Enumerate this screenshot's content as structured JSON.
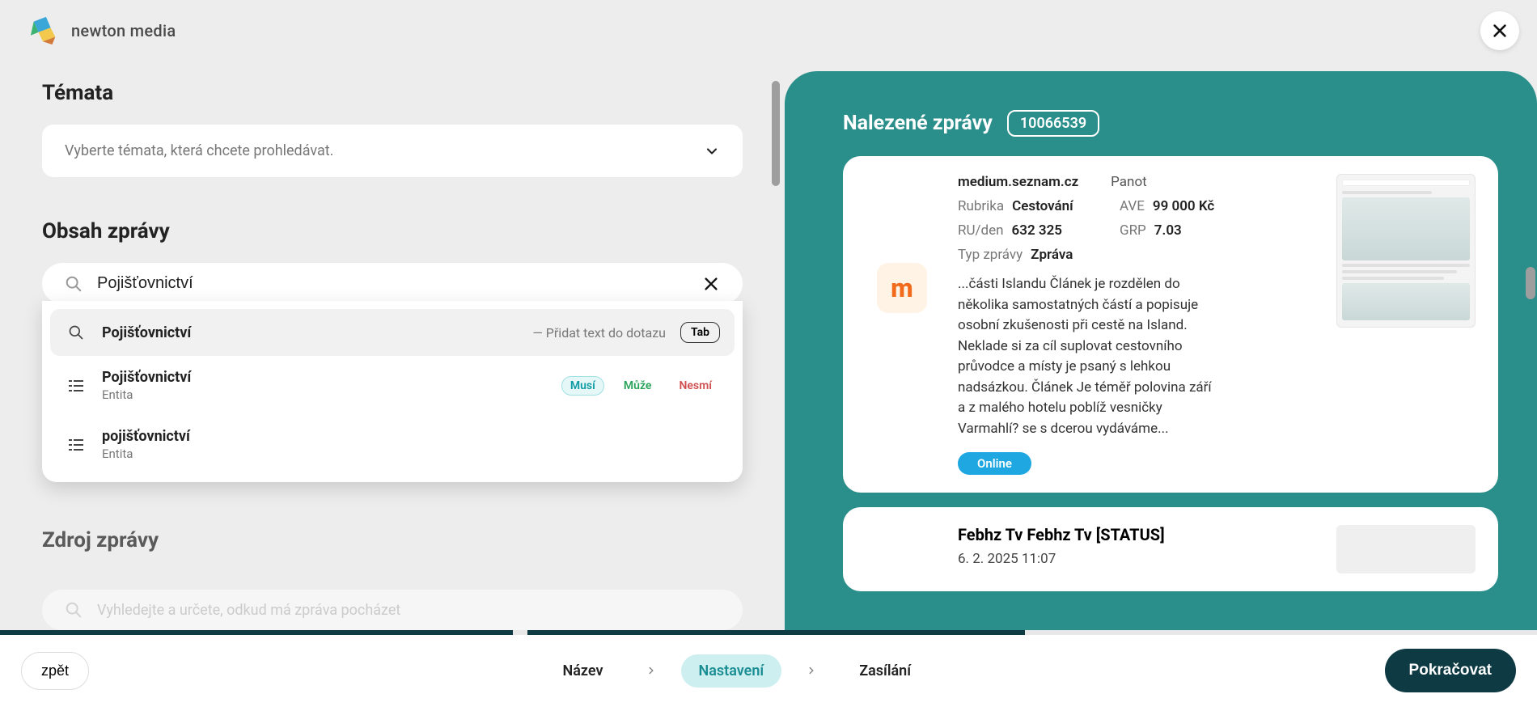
{
  "brand": {
    "name": "newton media"
  },
  "close_label": "close",
  "left": {
    "topics": {
      "title": "Témata",
      "placeholder": "Vyberte témata, která chcete prohledávat."
    },
    "content": {
      "title": "Obsah zprávy",
      "search_value": "Pojišťovnictví"
    },
    "dropdown": {
      "query_row": {
        "title": "Pojišťovnictví",
        "hint": "— Přidat text do dotazu",
        "key": "Tab"
      },
      "entities": [
        {
          "title": "Pojišťovnictví",
          "sub": "Entita",
          "tags": {
            "musi": "Musí",
            "muze": "Může",
            "nesmi": "Nesmí"
          }
        },
        {
          "title": "pojišťovnictví",
          "sub": "Entita"
        }
      ]
    },
    "source": {
      "title": "Zdroj zprávy",
      "placeholder": "Vyhledejte a určete, odkud má zpráva pocházet"
    }
  },
  "results": {
    "title": "Nalezené zprávy",
    "count": "10066539",
    "item1": {
      "source": "medium.seznam.cz",
      "panel": "Panot",
      "rubrika_label": "Rubrika",
      "rubrika": "Cestování",
      "ave_label": "AVE",
      "ave": "99 000 Kč",
      "ru_label": "RU/den",
      "ru": "632 325",
      "grp_label": "GRP",
      "grp": "7.03",
      "type_label": "Typ zprávy",
      "type": "Zpráva",
      "snippet": "...části Islandu Článek je rozdělen do několika samostatných částí a popisuje osobní zkušenosti při cestě na Island. Neklade si za cíl suplovat cestovního průvodce a místy je psaný s lehkou nadsázkou. Článek Je téměř polovina září a z malého hotelu poblíž vesničky Varmahlí? se s dcerou vydáváme...",
      "badge": "Online",
      "logo_letter": "m"
    },
    "item2": {
      "title": "Febhz Tv Febhz Tv [STATUS]",
      "date": "6. 2. 2025 11:07"
    }
  },
  "footer": {
    "back": "zpět",
    "steps": {
      "s1": "Název",
      "s2": "Nastavení",
      "s3": "Zasílání"
    },
    "continue": "Pokračovat"
  }
}
